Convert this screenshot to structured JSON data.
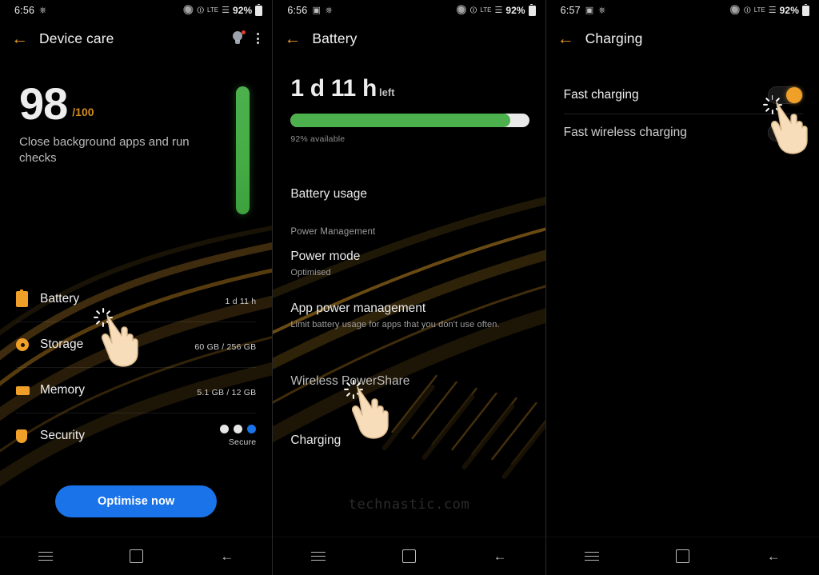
{
  "panels": [
    {
      "id": "device-care",
      "statusbar": {
        "time": "6:56",
        "battery_pct": "92%",
        "icons": [
          "image-icon",
          "dnd-icon",
          "bluetooth-icon",
          "wifi-icon",
          "lte-icon",
          "signal-icon",
          "battery-icon"
        ]
      },
      "appbar": {
        "title": "Device care",
        "back": "←",
        "actions": [
          "tips-bulb-icon",
          "overflow-menu-icon"
        ]
      },
      "score": {
        "value": "98",
        "denominator": "/100",
        "subtitle": "Close background apps and run checks",
        "bar_pct": 98
      },
      "rows": [
        {
          "icon": "battery-icon",
          "label": "Battery",
          "value": "1 d 11 h",
          "bar_pct": 92,
          "type": "bar"
        },
        {
          "icon": "storage-icon",
          "label": "Storage",
          "value": "60 GB / 256 GB",
          "bar_pct": 24,
          "type": "bar"
        },
        {
          "icon": "memory-icon",
          "label": "Memory",
          "value": "5.1 GB / 12 GB",
          "bar_pct": 43,
          "type": "bar"
        },
        {
          "icon": "security-icon",
          "label": "Security",
          "value": "Secure",
          "type": "dots"
        }
      ],
      "optimise_label": "Optimise now"
    },
    {
      "id": "battery",
      "statusbar": {
        "time": "6:56",
        "battery_pct": "92%"
      },
      "appbar": {
        "title": "Battery",
        "back": "←"
      },
      "remaining": {
        "value": "1 d 11 h",
        "unit": "left",
        "bar_pct": 92,
        "available": "92% available"
      },
      "items": [
        {
          "kind": "item",
          "title": "Battery usage",
          "subtitle": ""
        },
        {
          "kind": "section",
          "title": "Power Management"
        },
        {
          "kind": "item",
          "title": "Power mode",
          "subtitle": "Optimised"
        },
        {
          "kind": "item",
          "title": "App power management",
          "subtitle": "Limit battery usage for apps that you don't use often."
        },
        {
          "kind": "item",
          "title": "Wireless PowerShare",
          "subtitle": ""
        },
        {
          "kind": "item",
          "title": "Charging",
          "subtitle": ""
        }
      ],
      "watermark": "technastic.com"
    },
    {
      "id": "charging",
      "statusbar": {
        "time": "6:57",
        "battery_pct": "92%"
      },
      "appbar": {
        "title": "Charging",
        "back": "←"
      },
      "settings": [
        {
          "label": "Fast charging",
          "toggle": "on"
        },
        {
          "label": "Fast wireless charging",
          "toggle": "on"
        }
      ]
    }
  ],
  "navbar": {
    "recents": "recents-icon",
    "home": "home-icon",
    "back": "back-icon"
  },
  "colors": {
    "accent_orange": "#f0a028",
    "green": "#4cb04c",
    "blue": "#1a73e8",
    "background": "#000000"
  }
}
